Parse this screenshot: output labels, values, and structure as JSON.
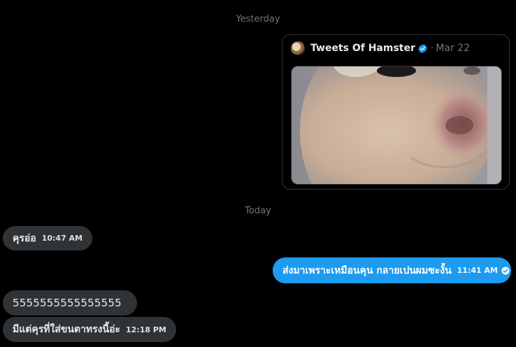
{
  "separators": {
    "yesterday": "Yesterday",
    "today": "Today"
  },
  "tweet": {
    "author": "Tweets Of Hamster",
    "dot": "·",
    "date": "Mar 22",
    "verified": true,
    "media_icon": "hamster-closeup-photo"
  },
  "messages": [
    {
      "text": "คุรอ่อ",
      "time": "10:47 AM",
      "direction": "incoming"
    },
    {
      "text": "ส่งมาเพราะเหมือนคุน กลายเปนผมซะงั้น",
      "time": "11:41 AM",
      "direction": "outgoing",
      "status_icon": "seen-check-icon"
    },
    {
      "text": "5555555555555555",
      "direction": "incoming"
    },
    {
      "text": "มีแต่คุรที่ใส่ขนตาทรงนี้อ่ะ",
      "time": "12:18 PM",
      "direction": "incoming"
    }
  ],
  "colors": {
    "background": "#000000",
    "incoming_bubble": "#2f3336",
    "outgoing_bubble": "#1d9bf0",
    "muted_text": "#71767b",
    "verified_blue": "#1d9bf0"
  }
}
